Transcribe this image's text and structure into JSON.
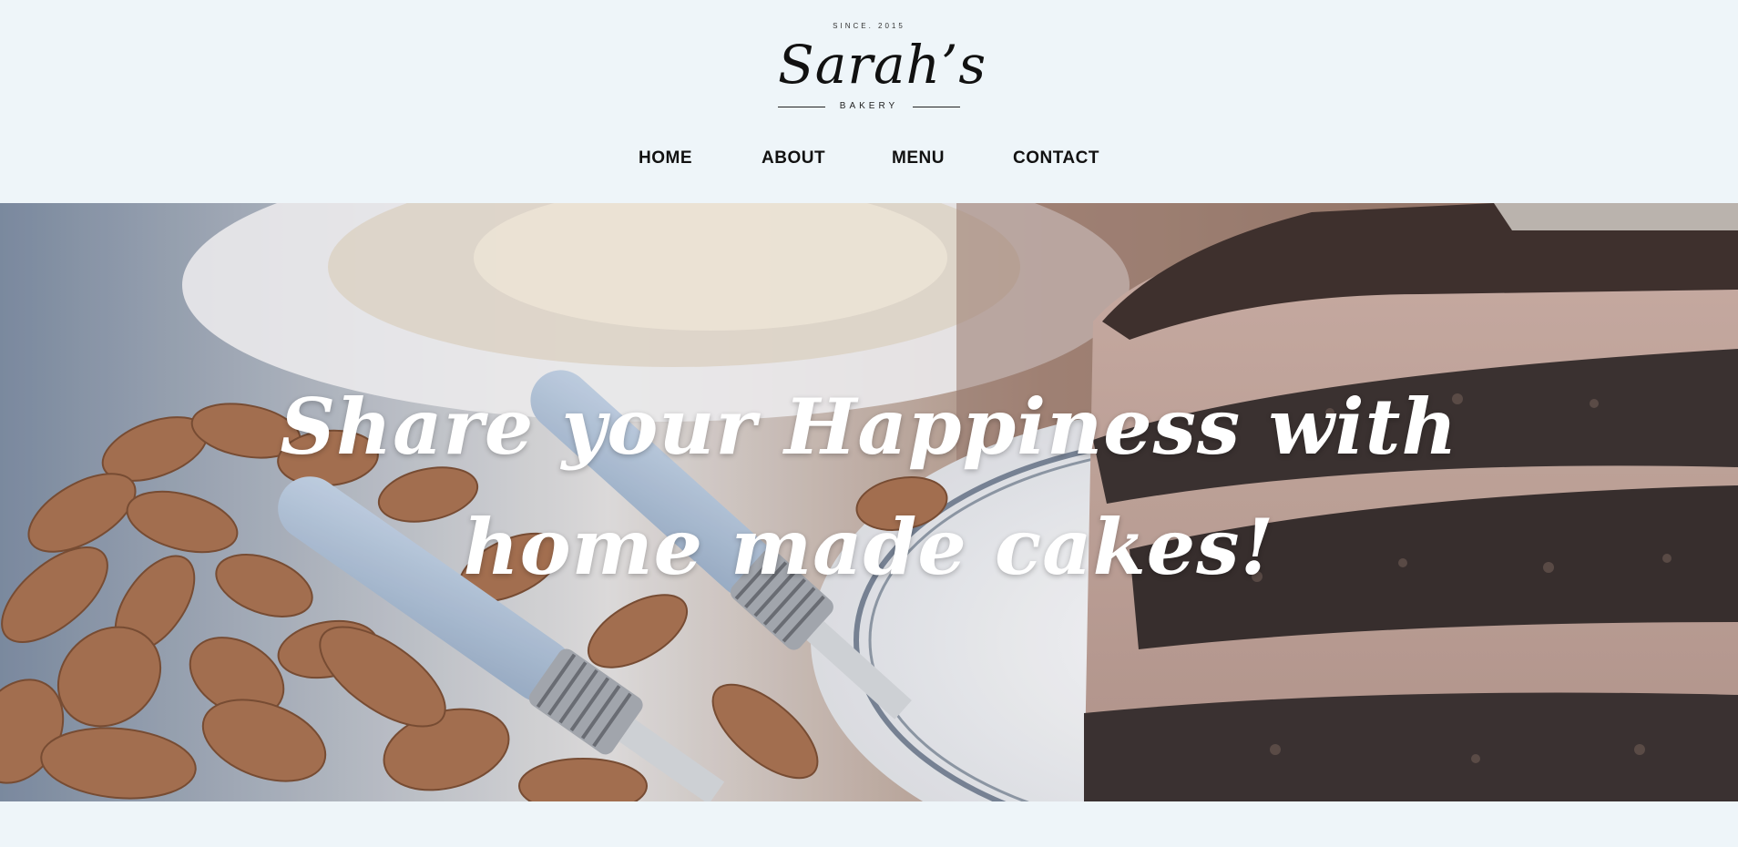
{
  "brand": {
    "since": "SINCE. 2015",
    "name": "Sarah’s",
    "tagline": "BAKERY"
  },
  "nav": {
    "items": [
      "HOME",
      "ABOUT",
      "MENU",
      "CONTACT"
    ]
  },
  "hero": {
    "title_line1": "Share your Happiness with",
    "title_line2": "home made cakes!",
    "image_alt": "chocolate-layer-cake-with-almonds-and-forks"
  },
  "colors": {
    "page_background": "#eef5f9",
    "text_dark": "#111111",
    "hero_text": "#ffffff"
  }
}
